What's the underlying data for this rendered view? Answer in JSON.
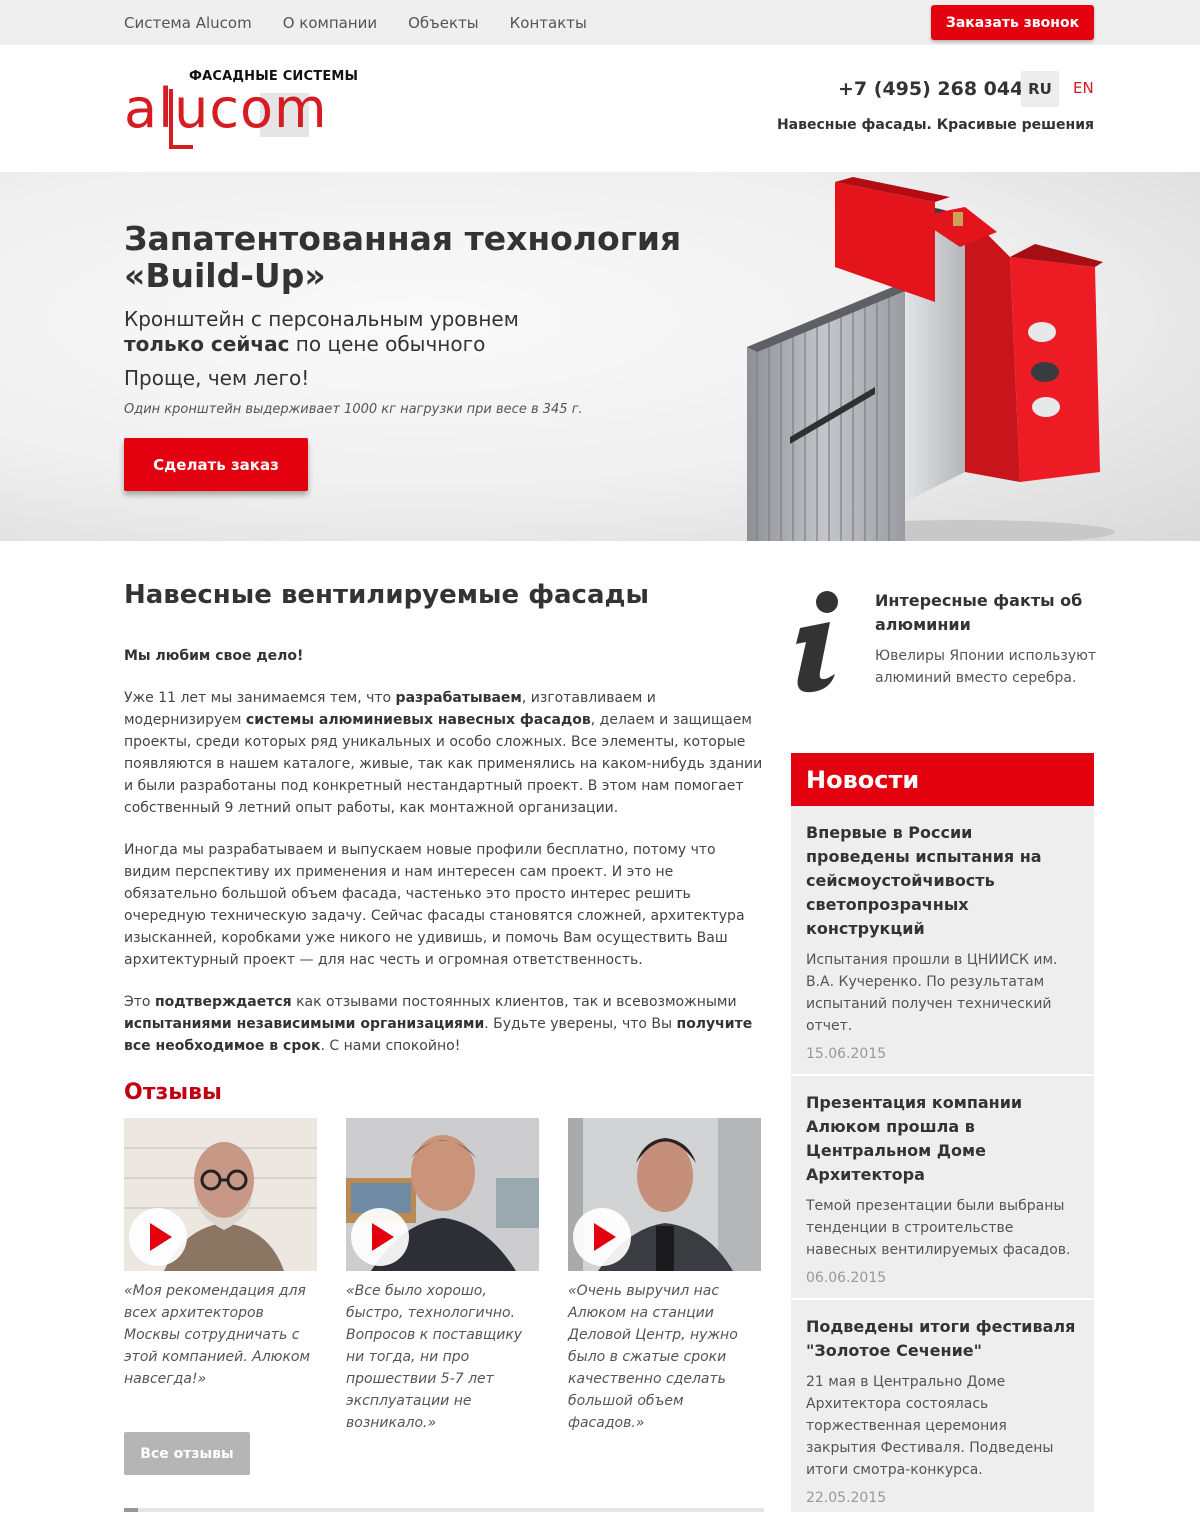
{
  "topnav": {
    "items": [
      "Система Alucom",
      "О компании",
      "Объекты",
      "Контакты"
    ],
    "call_button": "Заказать звонок"
  },
  "header": {
    "logo_sub": "ФАСАДНЫЕ СИСТЕМЫ",
    "logo_word": "alucom",
    "phone": "+7 (495) 268 0444",
    "lang_ru": "RU",
    "lang_en": "EN",
    "slogan": "Навесные фасады. Красивые решения"
  },
  "hero": {
    "title": "Запатентованная технология «Build-Up»",
    "sub_line1": "Кронштейн с персональным уровнем",
    "sub_bold": "только сейчас",
    "sub_rest": " по цене обычного",
    "simple": "Проще, чем лего!",
    "note": "Один кронштейн выдерживает 1000 кг нагрузки при весе в 345 г.",
    "button": "Сделать заказ"
  },
  "main": {
    "title": "Навесные вентилируемые фасады",
    "lead": "Мы любим свое дело!",
    "p1": {
      "a": "Уже 11 лет мы занимаемся тем, что ",
      "b1": "разрабатываем",
      "c": ", изготавливаем и модернизируем ",
      "b2": "системы алюминиевых навесных фасадов",
      "d": ", делаем и защищаем проекты, среди которых ряд уникальных и особо сложных. Все элементы, которые появляются в нашем каталоге, живые, так как применялись на каком-нибудь здании и были разработаны под конкретный нестандартный проект. В этом нам помогает собственный 9 летний опыт работы, как монтажной организации."
    },
    "p2": "Иногда мы разрабатываем и выпускаем новые профили бесплатно, потому что видим перспективу их применения и нам интересен сам проект. И это не обязательно большой объем фасада, частенько это просто интерес решить очередную техническую задачу. Сейчас фасады становятся сложней, архитектура изысканней, коробками уже никого не удивишь, и помочь Вам осуществить Ваш архитектурный проект — для нас честь и огромная ответственность.",
    "p3": {
      "a": "Это ",
      "b1": "подтверждается",
      "c": " как отзывами постоянных клиентов, так и всевозможными ",
      "b2": "испытаниями независимыми организациями",
      "d": ". Будьте уверены, что Вы ",
      "b3": "получите все необходимое в срок",
      "e": ". С нами спокойно!"
    }
  },
  "reviews": {
    "title": "Отзывы",
    "items": [
      {
        "quote": "«Моя рекомендация для всех архитекторов Москвы сотрудничать с этой компанией. Алюком навсегда!»"
      },
      {
        "quote": "«Все было хорошо, быстро, технологично. Вопросов к поставщику ни тогда, ни про прошествии 5-7 лет эксплуатации не возникало.»"
      },
      {
        "quote": "«Очень выручил нас Алюком на станции Деловой Центр, нужно было в сжатые сроки качественно сделать большой объем фасадов.»"
      }
    ],
    "all_button": "Все отзывы"
  },
  "facts": {
    "title": "Интересные факты об алюминии",
    "text": "Ювелиры Японии используют алюминий вместо серебра."
  },
  "news": {
    "title": "Новости",
    "items": [
      {
        "title": "Впервые в России проведены испытания на сейсмоустойчивость светопрозрачных конструкций",
        "text": "Испытания прошли в ЦНИИСК им. В.А. Кучеренко. По результатам испытаний получен технический отчет.",
        "date": "15.06.2015"
      },
      {
        "title": "Презентация компании Алюком прошла в Центральном Доме Архитектора",
        "text": "Темой презентации были выбраны тенденции в строительстве навесных вентилируемых фасадов.",
        "date": "06.06.2015"
      },
      {
        "title": "Подведены итоги фестиваля \"Золотое Сечение\"",
        "text": "21 мая в Центрально Доме Архитектора состоялась торжественная церемония закрытия Фестиваля. Подведены итоги смотра-конкурса.",
        "date": "22.05.2015"
      }
    ]
  },
  "colors": {
    "accent": "#e3000f",
    "brand": "#d51c23"
  }
}
